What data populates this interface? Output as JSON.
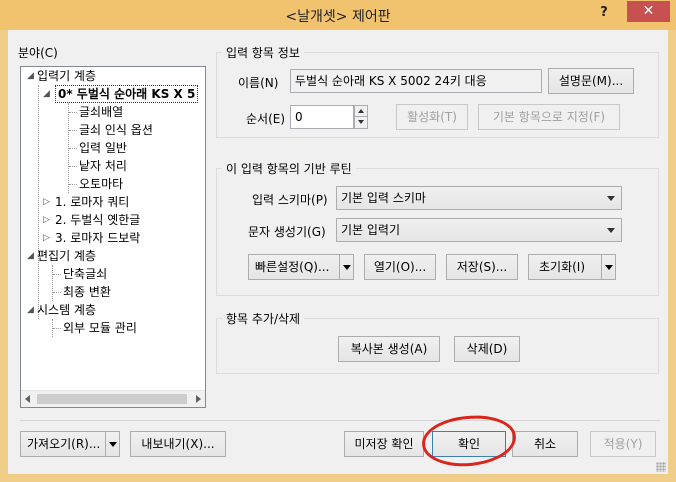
{
  "window": {
    "title": "<날개셋> 제어판",
    "help": "?",
    "close": "✕"
  },
  "sidebar": {
    "label": "분야(C)",
    "tree": [
      {
        "text": "입력기 계층",
        "toggle": "◢"
      },
      {
        "text": "0* 두벌식 순아래 KS X 5",
        "toggle": "◢"
      },
      {
        "text": "글쇠배열"
      },
      {
        "text": "글쇠 인식 옵션"
      },
      {
        "text": "입력 일반"
      },
      {
        "text": "낱자 처리"
      },
      {
        "text": "오토마타"
      },
      {
        "text": "1. 로마자 쿼티",
        "toggle": "▷"
      },
      {
        "text": "2. 두벌식 옛한글",
        "toggle": "▷"
      },
      {
        "text": "3. 로마자 드보락",
        "toggle": "▷"
      },
      {
        "text": "편집기 계층",
        "toggle": "◢"
      },
      {
        "text": "단축글쇠"
      },
      {
        "text": "최종 변환"
      },
      {
        "text": "시스템 계층",
        "toggle": "◢"
      },
      {
        "text": "외부 모듈 관리"
      }
    ]
  },
  "input_info": {
    "group_title": "입력 항목 정보",
    "name_label": "이름(N)",
    "name_value": "두벌식 순아래 KS X 5002 24키 대응",
    "desc_button": "설명문(M)...",
    "order_label": "순서(E)",
    "order_value": "0",
    "activate_button": "활성화(T)",
    "default_button": "기본 항목으로 지정(F)"
  },
  "base_routine": {
    "group_title": "이 입력 항목의 기반 루틴",
    "schema_label": "입력 스키마(P)",
    "schema_value": "기본 입력 스키마",
    "generator_label": "문자 생성기(G)",
    "generator_value": "기본 입력기",
    "quick_button": "빠른설정(Q)...",
    "open_button": "열기(O)...",
    "save_button": "저장(S)...",
    "reset_button": "초기화(I)"
  },
  "add_remove": {
    "group_title": "항목 추가/삭제",
    "copy_button": "복사본 생성(A)",
    "delete_button": "삭제(D)"
  },
  "footer": {
    "import_button": "가져오기(R)...",
    "export_button": "내보내기(X)...",
    "unsaved_button": "미저장 확인",
    "ok_button": "확인",
    "cancel_button": "취소",
    "apply_button": "적용(Y)"
  }
}
